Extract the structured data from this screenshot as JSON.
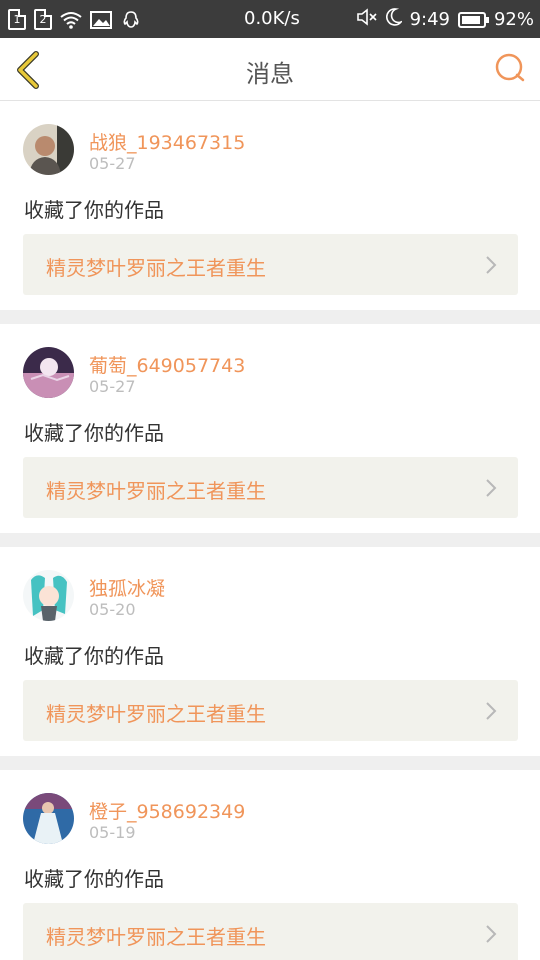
{
  "status_bar": {
    "sim1": "1",
    "sim2": "2",
    "network_speed": "0.0K/s",
    "time": "9:49",
    "battery": "92%",
    "icons": [
      "sim-card-1-icon",
      "sim-card-2-icon",
      "wifi-icon",
      "image-icon",
      "qq-icon",
      "mute-icon",
      "moon-icon",
      "battery-icon"
    ]
  },
  "header": {
    "title": "消息",
    "back_icon": "chevron-left-icon",
    "search_icon": "search-icon"
  },
  "colors": {
    "accent": "#f0955a",
    "back_icon": "#e8c93a",
    "link_bg": "#f2f2ec"
  },
  "messages": [
    {
      "username": "战狼_193467315",
      "date": "05-27",
      "action": "收藏了你的作品",
      "work_title": "精灵梦叶罗丽之王者重生"
    },
    {
      "username": "葡萄_649057743",
      "date": "05-27",
      "action": "收藏了你的作品",
      "work_title": "精灵梦叶罗丽之王者重生"
    },
    {
      "username": "独孤冰凝",
      "date": "05-20",
      "action": "收藏了你的作品",
      "work_title": "精灵梦叶罗丽之王者重生"
    },
    {
      "username": "橙子_958692349",
      "date": "05-19",
      "action": "收藏了你的作品",
      "work_title": "精灵梦叶罗丽之王者重生"
    }
  ]
}
